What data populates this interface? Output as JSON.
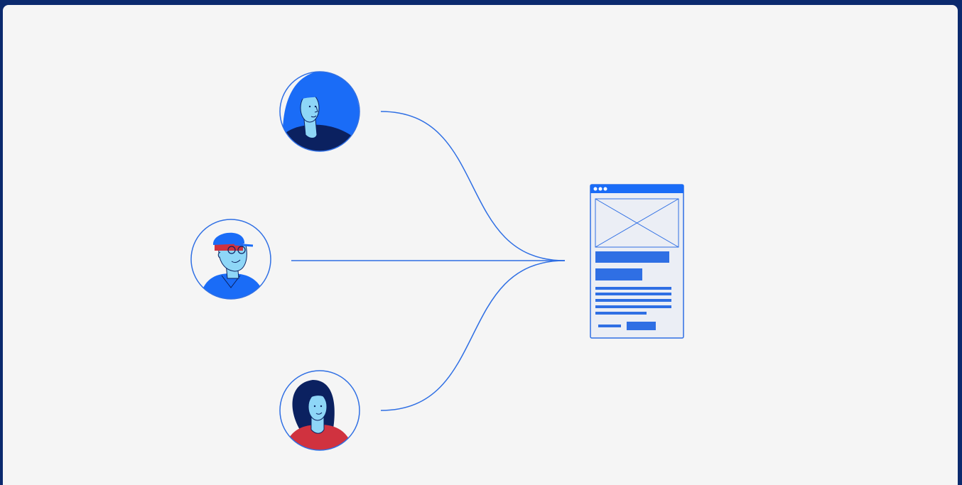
{
  "colors": {
    "outer_background": "#0b2a6e",
    "canvas_background": "#f5f5f5",
    "connector": "#2f6fe4",
    "accent_blue": "#1a6cf7",
    "navy": "#0b2160",
    "skin": "#8ed6f7",
    "red": "#d0323f",
    "page_background": "#ebeef5"
  },
  "diagram": {
    "people": [
      {
        "name": "woman-curly-hair",
        "icon": "avatar-woman-curly-hair-icon"
      },
      {
        "name": "man-cap-glasses",
        "icon": "avatar-man-cap-glasses-icon"
      },
      {
        "name": "woman-long-hair",
        "icon": "avatar-woman-long-hair-icon"
      }
    ],
    "target": {
      "icon": "webpage-wireframe-icon",
      "browser_dots": 3,
      "text_lines": 5
    }
  }
}
